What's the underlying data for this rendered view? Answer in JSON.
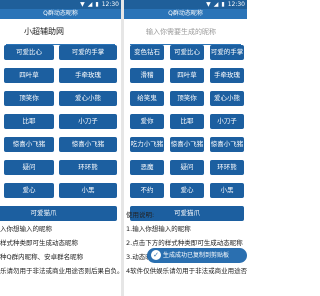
{
  "status_bar": {
    "time": "12:30"
  },
  "app_title": "Q群动态昵称",
  "left": {
    "input_value": "小超辅助网",
    "buttons": [
      [
        "",
        "可爱比心",
        "可爱的手掌"
      ],
      [
        "",
        "四叶草",
        "手牵玫瑰"
      ],
      [
        "",
        "顶笑你",
        "爱心小熊"
      ],
      [
        "",
        "比耶",
        "小刀子"
      ],
      [
        "",
        "惊喜小飞猪",
        "惊喜小飞猪"
      ],
      [
        "",
        "疑问",
        "环环熊"
      ],
      [
        "",
        "爱心",
        "小黑"
      ]
    ],
    "wide_button": "可爱猫爪",
    "help_lines": [
      "入你想输入的昵称",
      "样式种类即可生成动态昵称",
      "种Q群内昵称、安卓群名昵称",
      "乐请勿用于非法或商业用途否则后果自负。"
    ]
  },
  "right": {
    "input_placeholder": "输入你需要生成的昵称",
    "buttons": [
      [
        "变色钻石",
        "可爱比心",
        "可爱的手掌"
      ],
      [
        "滑稽",
        "四叶草",
        "手牵玫瑰"
      ],
      [
        "给笑鬼",
        "顶笑你",
        "爱心小熊"
      ],
      [
        "爱你",
        "比耶",
        "小刀子"
      ],
      [
        "吃力小飞猪",
        "惊喜小飞猪",
        "惊喜小飞猪"
      ],
      [
        "恶魔",
        "疑问",
        "环环熊"
      ],
      [
        "不约",
        "爱心",
        "小黑"
      ]
    ],
    "wide_button": "可爱猫爪",
    "help_title": "使用说明:",
    "help_lines": [
      "1.输入你想输入的昵称",
      "2.点击下方的样式种类即可生成动态昵称",
      "3.动态昵称",
      "4软件仅供娱乐请勿用于非法或商业用途否则后果自负。"
    ],
    "toast": "生成成功已复制到剪贴板"
  }
}
